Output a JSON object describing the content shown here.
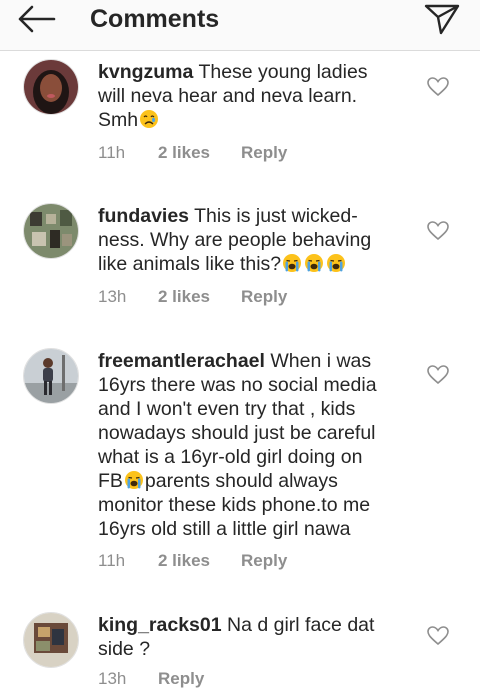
{
  "header": {
    "title": "Comments",
    "back_icon": "arrow-left-icon",
    "send_icon": "paper-plane-icon"
  },
  "comments": [
    {
      "username": "kvngzuma",
      "text_lines": [
        "These young ladies",
        "will neva hear and neva learn.",
        "Smh"
      ],
      "emojis": [
        "crying-face"
      ],
      "time": "11h",
      "likes": "2 likes",
      "reply": "Reply"
    },
    {
      "username": "fundavies",
      "text_lines": [
        "This is just wicked-",
        "ness. Why are people behaving",
        "like animals like this?"
      ],
      "emojis": [
        "loudly-crying-face",
        "loudly-crying-face",
        "loudly-crying-face"
      ],
      "time": "13h",
      "likes": "2 likes",
      "reply": "Reply"
    },
    {
      "username": "freemantlerachael",
      "text_lines": [
        "When i was",
        "16yrs there was no social media",
        "and I won't even try that , kids",
        "nowadays should just be careful",
        "what is a 16yr-old girl doing on",
        "FB",
        "parents should always",
        "monitor these kids phone.to me",
        "16yrs old still a little girl nawa"
      ],
      "emojis": [
        "loudly-crying-face"
      ],
      "time": "11h",
      "likes": "2 likes",
      "reply": "Reply"
    },
    {
      "username": "king_racks01",
      "text_lines": [
        "Na d girl face dat",
        "side ?"
      ],
      "emojis": [],
      "time": "13h",
      "likes": "",
      "reply": "Reply"
    }
  ],
  "colors": {
    "text": "#262626",
    "meta": "#8e8e8e",
    "divider": "#dbdbdb",
    "header_bg": "#fafafa",
    "emoji_face": "#fcc21b",
    "emoji_tear": "#4fa3e0"
  }
}
